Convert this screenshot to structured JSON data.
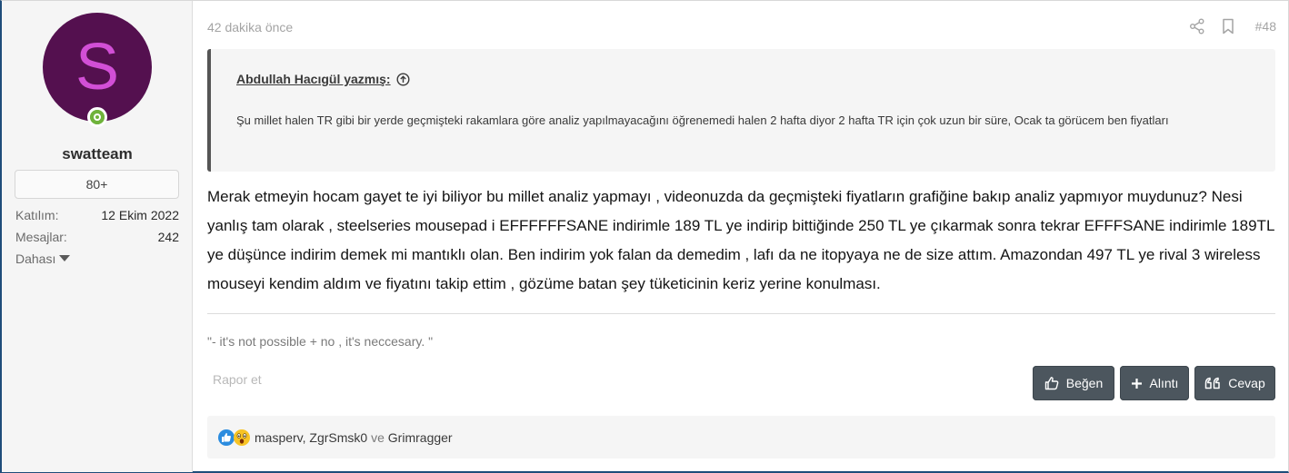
{
  "user": {
    "avatar_letter": "S",
    "username": "swatteam",
    "badge": "80+",
    "joined_label": "Katılım:",
    "joined_value": "12 Ekim 2022",
    "messages_label": "Mesajlar:",
    "messages_value": "242",
    "more_label": "Dahası"
  },
  "post": {
    "time": "42 dakika önce",
    "number": "#48",
    "quote": {
      "author": "Abdullah Hacıgül yazmış:",
      "text": "Şu millet halen TR gibi bir yerde geçmişteki rakamlara göre analiz yapılmayacağını öğrenemedi halen 2 hafta diyor 2 hafta TR için çok uzun bir süre, Ocak ta görücem ben fiyatları"
    },
    "message": "Merak etmeyin hocam gayet te iyi biliyor bu millet analiz yapmayı , videonuzda da geçmişteki fiyatların grafiğine bakıp analiz yapmıyor muydunuz? Nesi yanlış tam olarak , steelseries mousepad i EFFFFFFSANE indirimle 189 TL ye indirip bittiğinde 250 TL ye çıkarmak sonra tekrar EFFFSANE indirimle 189TL ye düşünce indirim demek mi mantıklı olan. Ben indirim yok falan da demedim , lafı da ne itopyaya ne de size attım. Amazondan 497 TL ye rival 3 wireless mouseyi kendim aldım ve fiyatını takip ettim , gözüme batan şey tüketicinin keriz yerine konulması.",
    "signature": "\"- it's not possible + no , it's neccesary. \"",
    "report": "Rapor et"
  },
  "actions": {
    "like": "Beğen",
    "quote": "Alıntı",
    "reply": "Cevap"
  },
  "reactions": {
    "users_a": "masperv, ZgrSmsk0",
    "and": "ve",
    "users_b": "Grimragger"
  }
}
